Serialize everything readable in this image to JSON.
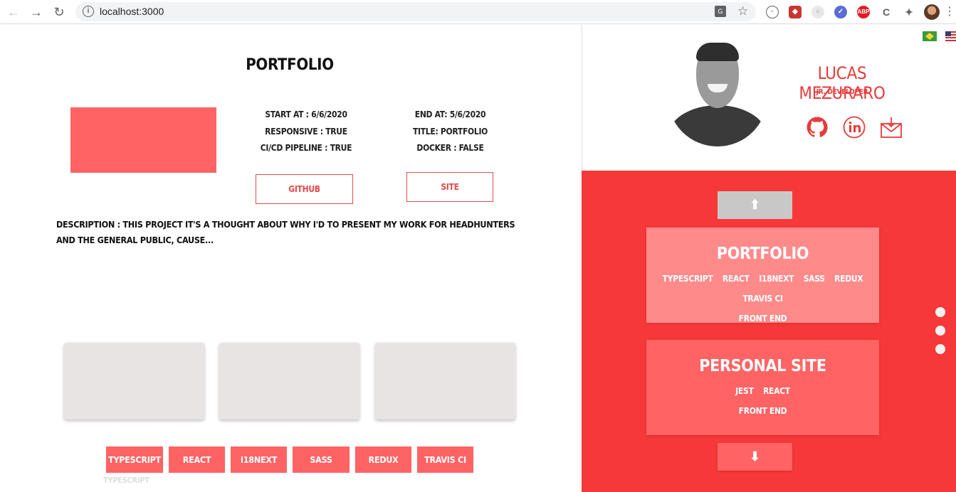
{
  "browser": {
    "url": "localhost:3000",
    "extension_icons": [
      "ext-a-icon",
      "ext-b-icon",
      "ext-c-icon",
      "ext-d-icon",
      "ext-e-icon",
      "ext-f-icon",
      "puzzle-icon"
    ]
  },
  "project": {
    "title": "PORTFOLIO",
    "start_at": "START AT : 6/6/2020",
    "responsive": "RESPONSIVE : TRUE",
    "cicd": "CI/CD PIPELINE : TRUE",
    "end_at": "END AT: 5/6/2020",
    "title_field": "TITLE: PORTFOLIO",
    "docker": "DOCKER : FALSE",
    "github_label": "GITHUB",
    "site_label": "SITE",
    "description": "DESCRIPTION : THIS PROJECT IT'S A THOUGHT ABOUT WHY I'D TO PRESENT MY WORK FOR HEADHUNTERS AND THE GENERAL PUBLIC, CAUSE...",
    "tags": [
      "TYPESCRIPT",
      "REACT",
      "I18NEXT",
      "SASS",
      "REDUX",
      "TRAVIS CI"
    ],
    "faded_tag": "TYPESCRIPT"
  },
  "profile": {
    "name": "LUCAS MEZURARO",
    "role": "JR. DEVELOPER",
    "flags": [
      "brazil-flag-icon",
      "usa-flag-icon"
    ],
    "socials": [
      "github-icon",
      "linkedin-icon",
      "email-icon"
    ]
  },
  "carousel": {
    "up_arrow": "⬆",
    "down_arrow": "⬇",
    "cards": [
      {
        "title": "PORTFOLIO",
        "techs": [
          "TYPESCRIPT",
          "REACT",
          "I18NEXT",
          "SASS",
          "REDUX",
          "TRAVIS CI"
        ],
        "area": "FRONT END"
      },
      {
        "title": "PERSONAL SITE",
        "techs": [
          "JEST",
          "REACT"
        ],
        "area": "FRONT END"
      }
    ]
  },
  "colors": {
    "accent": "#f73838",
    "tag": "#ff6363",
    "card_light": "#ff8a8a"
  }
}
